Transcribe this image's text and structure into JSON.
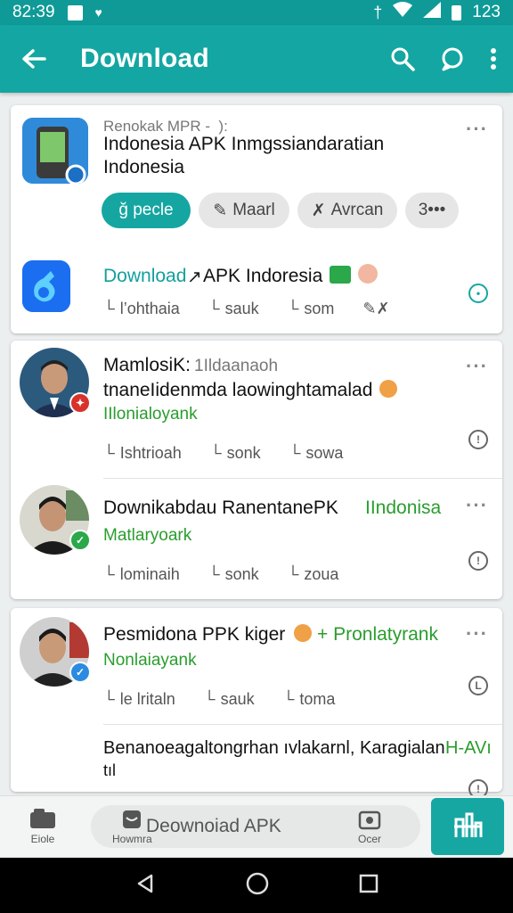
{
  "status_bar": {
    "time": "82:39",
    "battery": "123"
  },
  "app_bar": {
    "title": "Download"
  },
  "card1": {
    "item1": {
      "meta": "Renokak MPR -  ):",
      "title_line1": "Indonesia APK Inmgssiandaratian",
      "title_line2": "Indonesia",
      "chips": [
        "ğ pecle",
        "Maarl",
        "Avrcan",
        "3•••"
      ]
    },
    "item2": {
      "title_link": "Download",
      "title_rest": "APK Indoresia",
      "actions": [
        "l’ohthaia",
        "sauk",
        "som"
      ]
    }
  },
  "card2": {
    "item1": {
      "name": "MamlosiK:",
      "name_meta": "1Ildaanaoh",
      "text": "tnaneIidenmda laowinghtamalad",
      "sub": "IIlonialoyank",
      "actions": [
        "Ishtrioah",
        "sonk",
        "sowa"
      ]
    },
    "item2": {
      "text_dark": "Downikabdau RanentanePK",
      "text_green": "IIndonisa",
      "sub": "Matlaryoark",
      "actions": [
        "lominaih",
        "sonk",
        "zoua"
      ]
    }
  },
  "card3": {
    "item1": {
      "text_dark": "Pesmidona PPK kiger",
      "text_green": "+ Pronlatyrank",
      "sub": "Nonlaiayank",
      "actions": [
        "le lritaln",
        "sauk",
        "toma"
      ]
    },
    "item2": {
      "text_line1": "Benanoeagaltongrhan ıvlakarnl, Karagialan",
      "text_line1_green": "H-AVı",
      "text_line2": "tıl"
    }
  },
  "bottom_bar": {
    "left_label": "Eiole",
    "pill_small": "Howmra",
    "pill_text": "Deownoiad APK",
    "right_label": "Ocer"
  },
  "colors": {
    "primary": "#14a6a2",
    "accent_green": "#2a9d2e"
  }
}
